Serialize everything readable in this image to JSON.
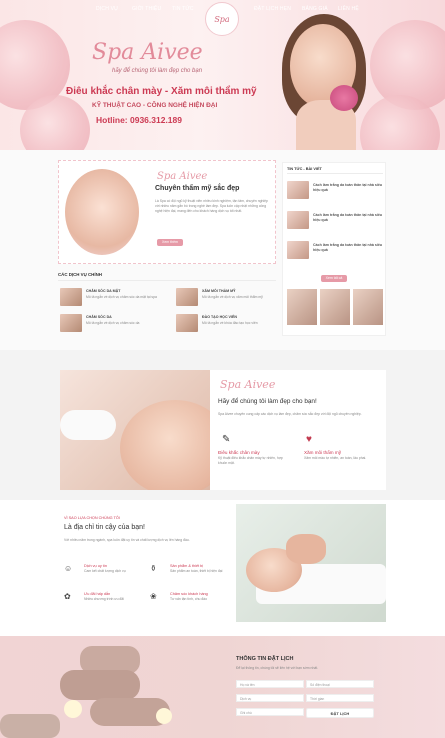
{
  "nav": {
    "items": [
      "DỊCH VỤ",
      "GIỚI THIỆU",
      "TIN TỨC",
      "ĐẶT LỊCH HẸN",
      "BẢNG GIÁ",
      "LIÊN HỆ"
    ],
    "logo": "Spa"
  },
  "hero": {
    "brand": "Spa Aivee",
    "tagline": "hãy để chúng tôi làm đẹp cho bạn",
    "headline": "Điêu khắc chân mày - Xăm môi thẩm mỹ",
    "subline": "KỸ THUẬT CAO - CÔNG NGHỆ HIỆN ĐẠI",
    "hotline": "Hotline: 0936.312.189"
  },
  "about": {
    "script": "Spa Aivee",
    "title": "Chuyên thẩm mỹ sắc đẹp",
    "text": "Là Spa có đội ngũ kỹ thuật viên nhiều kinh nghiệm, tận tâm, chuyên nghiệp với nhiều năm gắn bó trong nghề làm đẹp. Spa luôn cập nhật những công nghệ hiện đại, mang đến cho khách hàng dịch vụ tốt nhất.",
    "button": "Xem thêm"
  },
  "services": {
    "heading": "CÁC DỊCH VỤ CHÍNH",
    "items": [
      {
        "title": "CHĂM SÓC DA MẶT",
        "desc": "Mô tả ngắn về dịch vụ chăm sóc da mặt tại spa"
      },
      {
        "title": "XĂM MÔI THẨM MỸ",
        "desc": "Mô tả ngắn về dịch vụ xăm môi thẩm mỹ"
      },
      {
        "title": "CHĂM SÓC DA",
        "desc": "Mô tả ngắn về dịch vụ chăm sóc da"
      },
      {
        "title": "ĐÀO TẠO HỌC VIÊN",
        "desc": "Mô tả ngắn về khóa đào tạo học viên"
      }
    ]
  },
  "news": {
    "heading": "TIN TỨC - BÀI VIẾT",
    "items": [
      "Cách làm trắng da toàn thân tại nhà siêu hiệu quả",
      "Cách làm trắng da toàn thân tại nhà siêu hiệu quả",
      "Cách làm trắng da toàn thân tại nhà siêu hiệu quả"
    ],
    "button": "Xem tất cả"
  },
  "feature": {
    "script": "Spa Aivee",
    "title": "Hãy để chúng tôi làm đẹp cho bạn!",
    "text": "Spa Aivee chuyên cung cấp các dịch vụ làm đẹp, chăm sóc sắc đẹp với đội ngũ chuyên nghiệp.",
    "item1_title": "Điêu khắc chân mày",
    "item1_text": "Kỹ thuật điêu khắc chân mày tự nhiên, hợp khuôn mặt.",
    "item2_title": "Xăm môi thẩm mỹ",
    "item2_text": "Xăm môi màu tự nhiên, an toàn, lâu phai."
  },
  "why": {
    "kicker": "VÌ SAO LỰA CHỌN CHÚNG TÔI",
    "title": "Là địa chỉ tin cậy của bạn!",
    "text": "Với nhiều năm trong ngành, spa luôn đặt uy tín và chất lượng dịch vụ lên hàng đầu.",
    "items": [
      {
        "title": "Dịch vụ uy tín",
        "desc": "Cam kết chất lượng dịch vụ"
      },
      {
        "title": "Sản phẩm & thiết bị",
        "desc": "Sản phẩm an toàn, thiết bị hiện đại"
      },
      {
        "title": "Ưu đãi hấp dẫn",
        "desc": "Nhiều chương trình ưu đãi"
      },
      {
        "title": "Chăm sóc khách hàng",
        "desc": "Tư vấn tận tình, chu đáo"
      }
    ]
  },
  "booking": {
    "heading": "THÔNG TIN ĐẶT LỊCH",
    "intro": "Để lại thông tin, chúng tôi sẽ liên hệ với bạn sớm nhất.",
    "name_ph": "Họ và tên",
    "phone_ph": "Số điện thoại",
    "service_ph": "Dịch vụ",
    "time_ph": "Thời gian",
    "note_ph": "Ghi chú",
    "button": "ĐẶT LỊCH"
  }
}
